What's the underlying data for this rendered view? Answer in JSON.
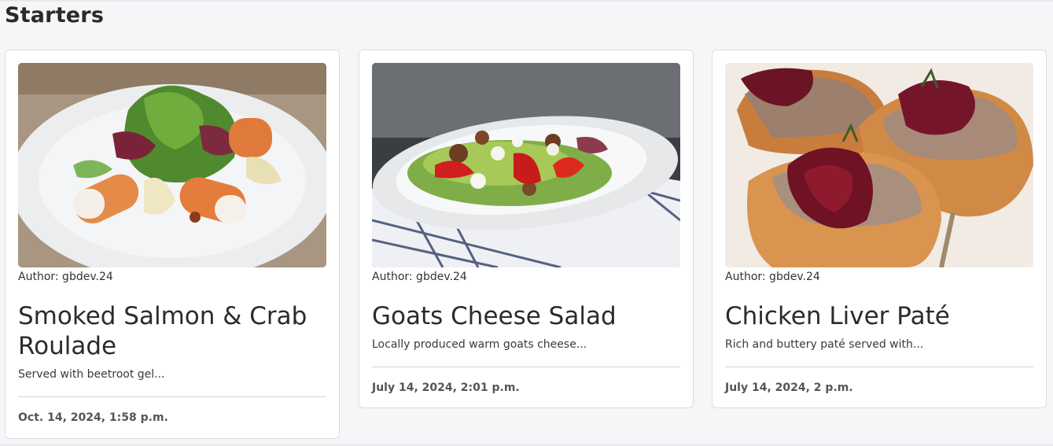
{
  "section": {
    "title": "Starters"
  },
  "cards": [
    {
      "image_name": "smoked-salmon-crab-roulade-photo",
      "author": "Author: gbdev.24",
      "title": "Smoked Salmon & Crab Roulade",
      "description": "Served with beetroot gel...",
      "date": "Oct. 14, 2024, 1:58 p.m."
    },
    {
      "image_name": "goats-cheese-salad-photo",
      "author": "Author: gbdev.24",
      "title": "Goats Cheese Salad",
      "description": "Locally produced warm goats cheese...",
      "date": "July 14, 2024, 2:01 p.m."
    },
    {
      "image_name": "chicken-liver-pate-photo",
      "author": "Author: gbdev.24",
      "title": "Chicken Liver Paté",
      "description": "Rich and buttery paté served with...",
      "date": "July 14, 2024, 2 p.m."
    }
  ]
}
